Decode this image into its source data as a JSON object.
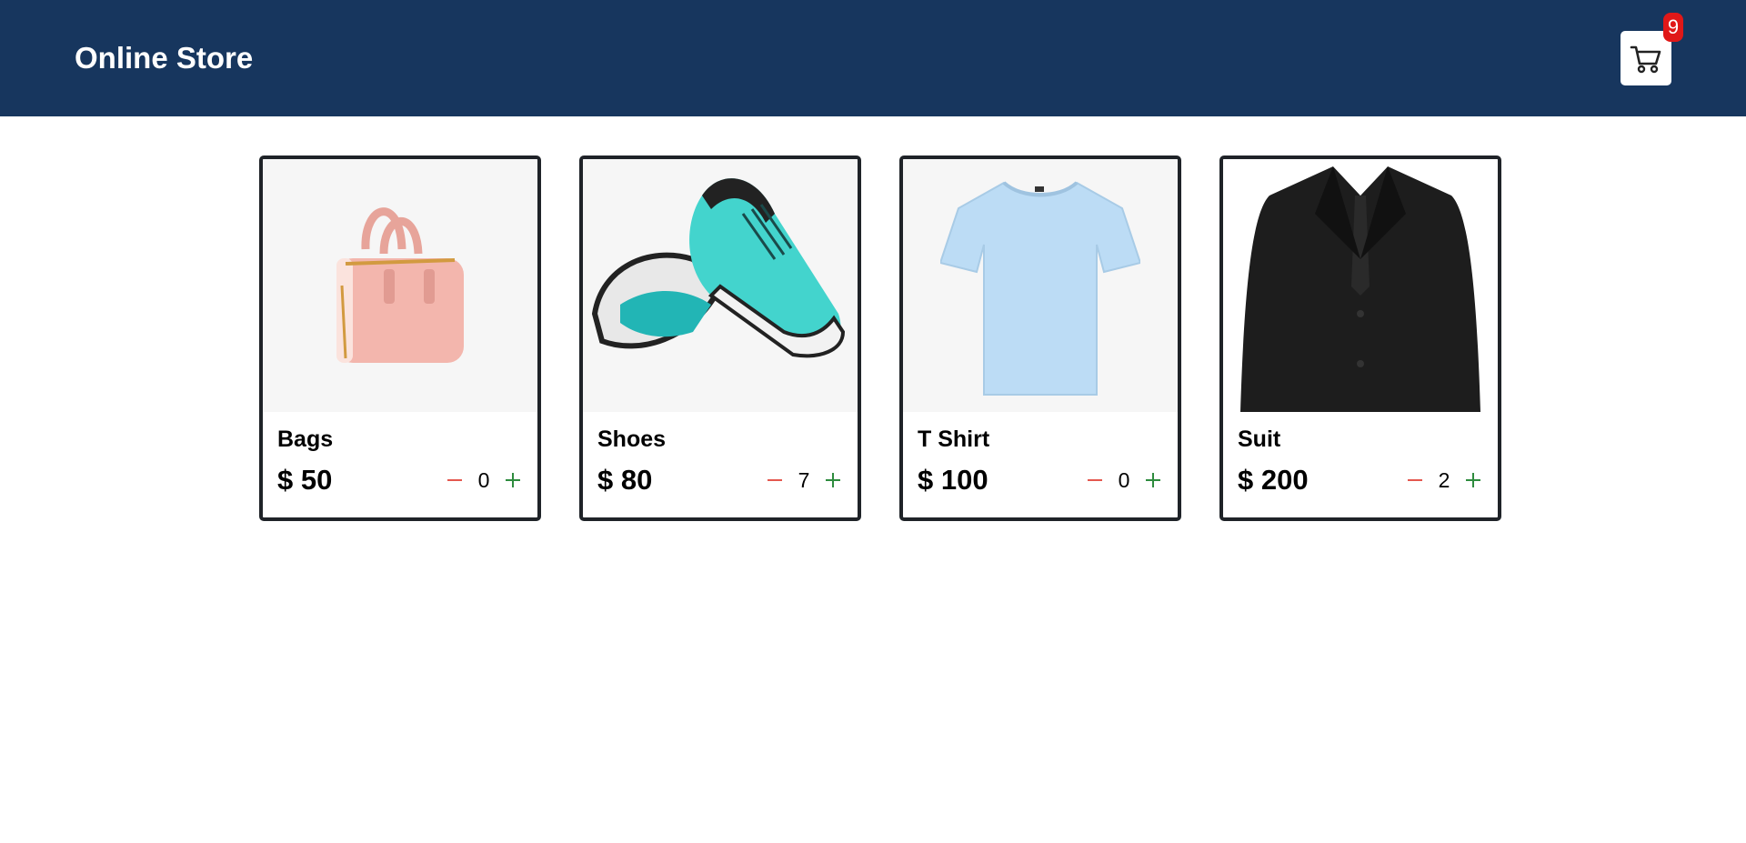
{
  "header": {
    "title": "Online Store",
    "cart_count": "9",
    "cart_icon": "cart-icon"
  },
  "colors": {
    "header_bg": "#17365e",
    "badge": "#e01818",
    "minus": "#e4574f",
    "plus": "#2e8b3e"
  },
  "products": [
    {
      "name": "Bags",
      "price": "$ 50",
      "qty": "0",
      "image": "pink-handbag"
    },
    {
      "name": "Shoes",
      "price": "$ 80",
      "qty": "7",
      "image": "teal-running-shoes"
    },
    {
      "name": "T Shirt",
      "price": "$ 100",
      "qty": "0",
      "image": "light-blue-tshirt"
    },
    {
      "name": "Suit",
      "price": "$ 200",
      "qty": "2",
      "image": "black-suit"
    }
  ]
}
